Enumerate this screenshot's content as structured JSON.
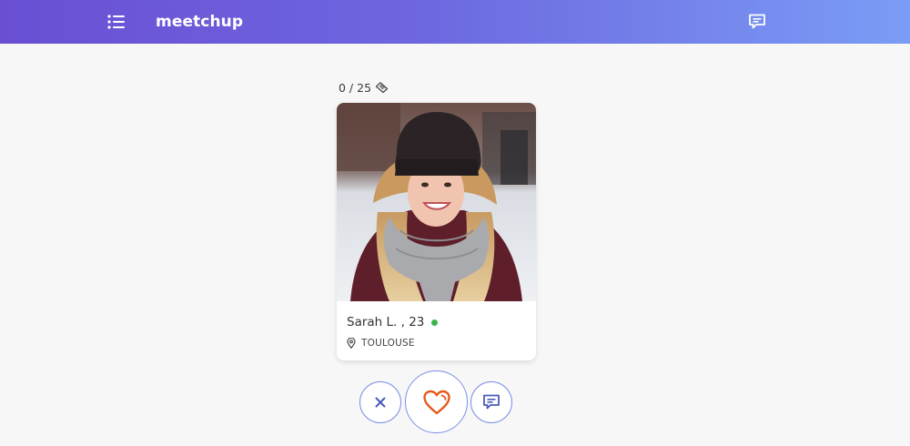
{
  "header": {
    "brand": "meetchup",
    "menu_icon": "list-menu-icon",
    "messages_icon": "chat-bubble-icon"
  },
  "counter": {
    "text": "0 / 25",
    "icon": "ticket-icon"
  },
  "profile": {
    "name_age": "Sarah L. , 23",
    "online": true,
    "location": "TOULOUSE",
    "location_icon": "location-pin-icon",
    "photo": "profile-photo"
  },
  "actions": {
    "skip_icon": "close-icon",
    "like_icon": "heart-icon",
    "chat_icon": "chat-bubble-icon"
  },
  "colors": {
    "header_start": "#6a4fd3",
    "header_end": "#7a9cf6",
    "button_border": "#7b8fe6",
    "online": "#3bb54a",
    "heart": "#e35b1e",
    "icon_blue": "#4a5bb8"
  }
}
